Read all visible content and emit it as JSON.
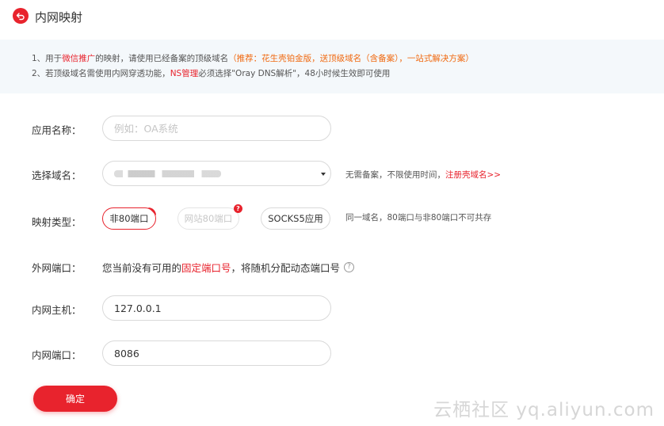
{
  "header": {
    "title": "内网映射"
  },
  "notice": {
    "line1_a": "1、用于",
    "line1_b": "微信推广",
    "line1_c": "的映射，请使用已经备案的顶级域名",
    "line1_d": "（推荐：花生壳铂金版，送顶级域名（含备案），一站式解决方案）",
    "line2_a": "2、若顶级域名需使用内网穿透功能，",
    "line2_b": "NS管理",
    "line2_c": "必须选择\"Oray DNS解析\"，48小时候生效即可使用"
  },
  "form": {
    "app_name": {
      "label": "应用名称：",
      "placeholder": "例如：OA系统",
      "value": ""
    },
    "domain": {
      "label": "选择域名：",
      "hint_a": "无需备案，不限使用时间，",
      "hint_link": "注册壳域名>>"
    },
    "map_type": {
      "label": "映射类型：",
      "options": [
        "非80端口",
        "网站80端口",
        "SOCKS5应用"
      ],
      "selected": "非80端口",
      "badge": "?",
      "hint": "同一域名，80端口与非80端口不可共存"
    },
    "external_port": {
      "label": "外网端口：",
      "text_a": "您当前没有可用的",
      "text_link": "固定端口号",
      "text_b": "，将随机分配动态端口号",
      "help": "?"
    },
    "internal_host": {
      "label": "内网主机：",
      "value": "127.0.0.1"
    },
    "internal_port": {
      "label": "内网端口：",
      "value": "8086"
    }
  },
  "confirm_label": "确定",
  "watermark": "云栖社区 yq.aliyun.com",
  "colors": {
    "accent": "#e8232d",
    "orange": "#f06a12",
    "notice_bg": "#f4f8fb"
  }
}
